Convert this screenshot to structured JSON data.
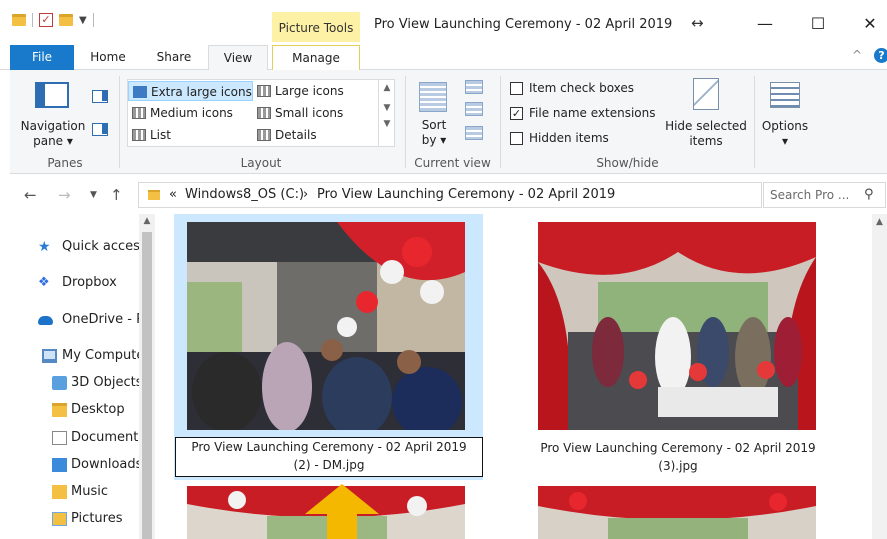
{
  "titlebar": {
    "contextual_tab": "Picture Tools",
    "window_title": "Pro View Launching Ceremony - 02 April 2019",
    "minimize_glyph": "—",
    "maximize_glyph": "☐",
    "close_glyph": "✕",
    "resize_glyph": "↔"
  },
  "tabs": {
    "file": "File",
    "home": "Home",
    "share": "Share",
    "view": "View",
    "manage": "Manage"
  },
  "ribbon": {
    "panes": {
      "navigation_pane_label": "Navigation pane ▾",
      "group_label": "Panes"
    },
    "layout": {
      "items": [
        "Extra large icons",
        "Large icons",
        "Medium icons",
        "Small icons",
        "List",
        "Details"
      ],
      "group_label": "Layout"
    },
    "current_view": {
      "sort_label": "Sort by ▾",
      "group_label": "Current view"
    },
    "show_hide": {
      "item_check_boxes": "Item check boxes",
      "file_name_extensions": "File name extensions",
      "hidden_items": "Hidden items",
      "file_name_extensions_checked": true,
      "hide_selected_label": "Hide selected items",
      "group_label": "Show/hide"
    },
    "options": {
      "label": "Options ▾"
    }
  },
  "address": {
    "crumb_overflow": "«",
    "drive": "Windows8_OS (C:)",
    "separator": "›",
    "folder": "Pro View Launching Ceremony - 02 April 2019",
    "search_placeholder": "Search Pro ..."
  },
  "nav_pane": {
    "items": [
      "Quick access",
      "Dropbox",
      "OneDrive - Personal",
      "My Computer",
      "3D Objects",
      "Desktop",
      "Documents",
      "Downloads",
      "Music",
      "Pictures"
    ]
  },
  "files": [
    {
      "rename_line1": "Pro View Launching Ceremony - 02 April 2019",
      "rename_line2": "(2) - DM.jpg",
      "selected": true
    },
    {
      "line1": "Pro View Launching Ceremony - 02 April 2019",
      "line2": "(3).jpg",
      "selected": false
    }
  ],
  "colors": {
    "accent": "#1979ca",
    "selection": "#cce8ff",
    "picture_tools": "#fdf1a6",
    "pointer_arrow": "#f5b800"
  }
}
